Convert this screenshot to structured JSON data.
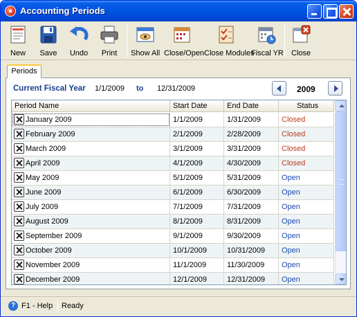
{
  "window": {
    "title": "Accounting Periods"
  },
  "toolbar": {
    "new": "New",
    "save": "Save",
    "undo": "Undo",
    "print": "Print",
    "show_all": "Show All",
    "close_open": "Close/Open",
    "close_modules": "Close Modules",
    "fiscal_yr": "Fiscal YR",
    "close": "Close"
  },
  "tabs": {
    "periods": "Periods"
  },
  "fiscal": {
    "label": "Current Fiscal Year",
    "from": "1/1/2009",
    "to_label": "to",
    "to": "12/31/2009",
    "year": "2009"
  },
  "grid": {
    "headers": {
      "name": "Period Name",
      "start": "Start Date",
      "end": "End Date",
      "status": "Status"
    },
    "rows": [
      {
        "name": "January 2009",
        "start": "1/1/2009",
        "end": "1/31/2009",
        "status": "Closed"
      },
      {
        "name": "February 2009",
        "start": "2/1/2009",
        "end": "2/28/2009",
        "status": "Closed"
      },
      {
        "name": "March 2009",
        "start": "3/1/2009",
        "end": "3/31/2009",
        "status": "Closed"
      },
      {
        "name": "April 2009",
        "start": "4/1/2009",
        "end": "4/30/2009",
        "status": "Closed"
      },
      {
        "name": "May 2009",
        "start": "5/1/2009",
        "end": "5/31/2009",
        "status": "Open"
      },
      {
        "name": "June 2009",
        "start": "6/1/2009",
        "end": "6/30/2009",
        "status": "Open"
      },
      {
        "name": "July 2009",
        "start": "7/1/2009",
        "end": "7/31/2009",
        "status": "Open"
      },
      {
        "name": "August 2009",
        "start": "8/1/2009",
        "end": "8/31/2009",
        "status": "Open"
      },
      {
        "name": "September 2009",
        "start": "9/1/2009",
        "end": "9/30/2009",
        "status": "Open"
      },
      {
        "name": "October 2009",
        "start": "10/1/2009",
        "end": "10/31/2009",
        "status": "Open"
      },
      {
        "name": "November 2009",
        "start": "11/1/2009",
        "end": "11/30/2009",
        "status": "Open"
      },
      {
        "name": "December 2009",
        "start": "12/1/2009",
        "end": "12/31/2009",
        "status": "Open"
      }
    ]
  },
  "statusbar": {
    "help": "F1 - Help",
    "ready": "Ready"
  },
  "colors": {
    "closed": "#c0391b",
    "open": "#1c4bb0",
    "titlebar": "#0054e3"
  },
  "icons": {
    "title": "app-icon",
    "new": "new-document-icon",
    "save": "floppy-disk-icon",
    "undo": "undo-arrow-icon",
    "print": "printer-icon",
    "show_all": "show-all-icon",
    "close_open": "calendar-icon",
    "close_modules": "checklist-icon",
    "fiscal_yr": "fiscal-calendar-icon",
    "close": "close-window-icon",
    "help": "help-icon"
  }
}
